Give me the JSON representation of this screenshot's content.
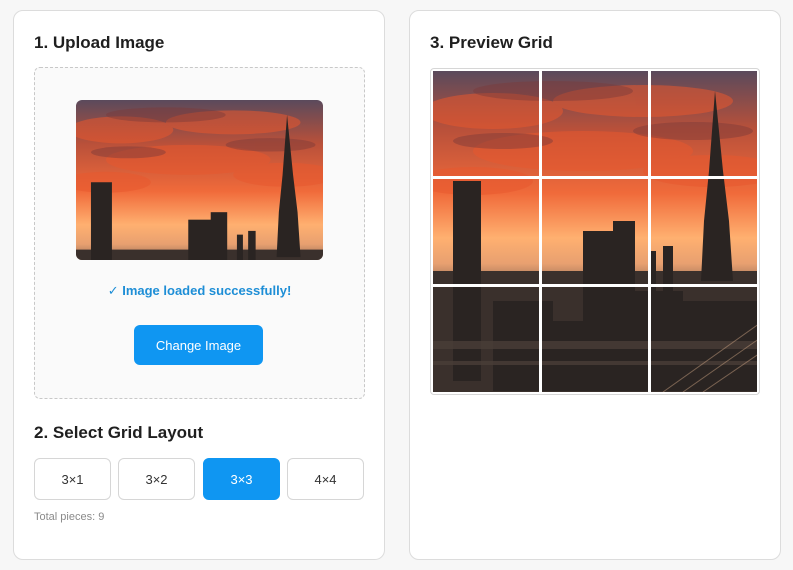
{
  "upload": {
    "title": "1. Upload Image",
    "status": "✓ Image loaded successfully!",
    "change_button": "Change Image",
    "image_alt": "city-skyline-sunset"
  },
  "layout": {
    "title": "2. Select Grid Layout",
    "options": [
      "3×1",
      "3×2",
      "3×3",
      "4×4"
    ],
    "selected": "3×3",
    "total_label": "Total pieces: 9"
  },
  "preview": {
    "title": "3. Preview Grid",
    "rows": 3,
    "cols": 3
  },
  "colors": {
    "accent": "#0f96f2",
    "success": "#1e8ed6",
    "sky_top": "#3a4a6a",
    "sky_glow": "#ff7a3c"
  }
}
